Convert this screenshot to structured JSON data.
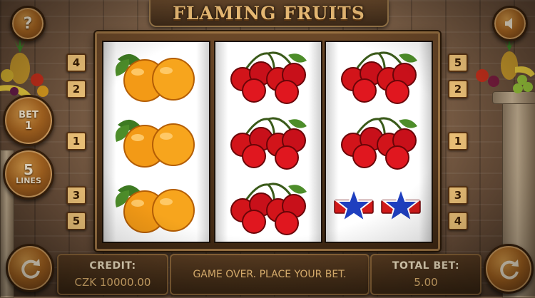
{
  "game": {
    "title": "FLAMING FRUITS"
  },
  "buttons": {
    "help_label": "?",
    "bet_label": "BET",
    "bet_value": "1",
    "lines_value": "5",
    "lines_label": "LINES"
  },
  "markers": {
    "left": [
      "4",
      "2",
      "1",
      "3",
      "5"
    ],
    "right": [
      "5",
      "2",
      "1",
      "3",
      "4"
    ]
  },
  "reels": [
    [
      "orange",
      "orange",
      "orange"
    ],
    [
      "cherry",
      "cherry",
      "cherry"
    ],
    [
      "cherry",
      "cherry",
      "star"
    ]
  ],
  "bottom": {
    "credit_label": "CREDIT:",
    "credit_value": "CZK 10000.00",
    "message": "GAME OVER. PLACE YOUR BET.",
    "total_bet_label": "TOTAL BET:",
    "total_bet_value": "5.00"
  },
  "colors": {
    "accent": "#f3c37a",
    "wood": "#3e2a18"
  }
}
